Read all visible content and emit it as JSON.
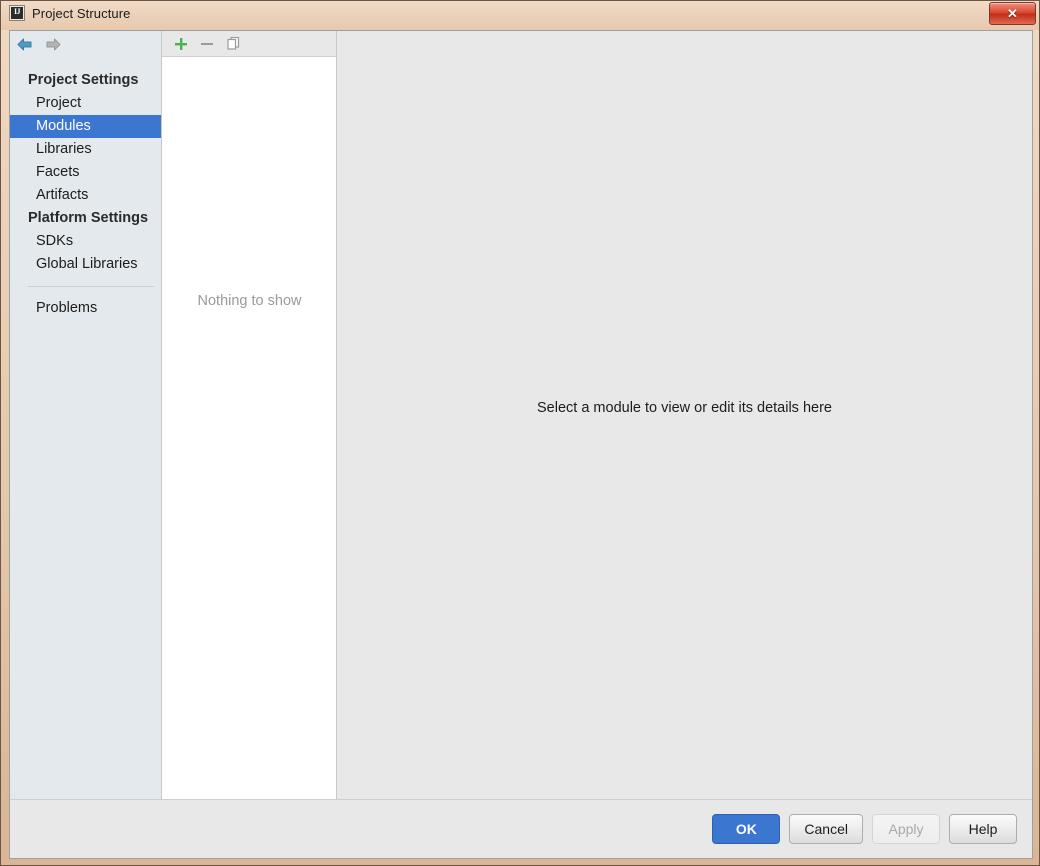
{
  "window": {
    "title": "Project Structure",
    "app_icon": "intellij-idea-icon",
    "close_label": "✕"
  },
  "nav": {
    "back_icon": "arrow-left-icon",
    "forward_icon": "arrow-right-icon"
  },
  "sidebar": {
    "groups": [
      {
        "label": "Project Settings",
        "items": [
          {
            "label": "Project",
            "selected": false
          },
          {
            "label": "Modules",
            "selected": true
          },
          {
            "label": "Libraries",
            "selected": false
          },
          {
            "label": "Facets",
            "selected": false
          },
          {
            "label": "Artifacts",
            "selected": false
          }
        ]
      },
      {
        "label": "Platform Settings",
        "items": [
          {
            "label": "SDKs",
            "selected": false
          },
          {
            "label": "Global Libraries",
            "selected": false
          }
        ]
      }
    ],
    "footer_item": {
      "label": "Problems"
    }
  },
  "middle_panel": {
    "toolbar": [
      {
        "name": "add-button",
        "icon": "plus-icon",
        "enabled": true
      },
      {
        "name": "remove-button",
        "icon": "minus-icon",
        "enabled": false
      },
      {
        "name": "copy-button",
        "icon": "copy-icon",
        "enabled": false
      }
    ],
    "empty_text": "Nothing to show"
  },
  "right_panel": {
    "message": "Select a module to view or edit its details here"
  },
  "buttons": {
    "ok": "OK",
    "cancel": "Cancel",
    "apply": "Apply",
    "help": "Help"
  },
  "colors": {
    "accent_blue": "#3b77d1",
    "titlebar_tan": "#e6c9ae",
    "sidebar_bg": "#e4e9ed",
    "panel_bg": "#e8e8e8",
    "close_red": "#d9432c",
    "plus_green": "#49b349"
  }
}
